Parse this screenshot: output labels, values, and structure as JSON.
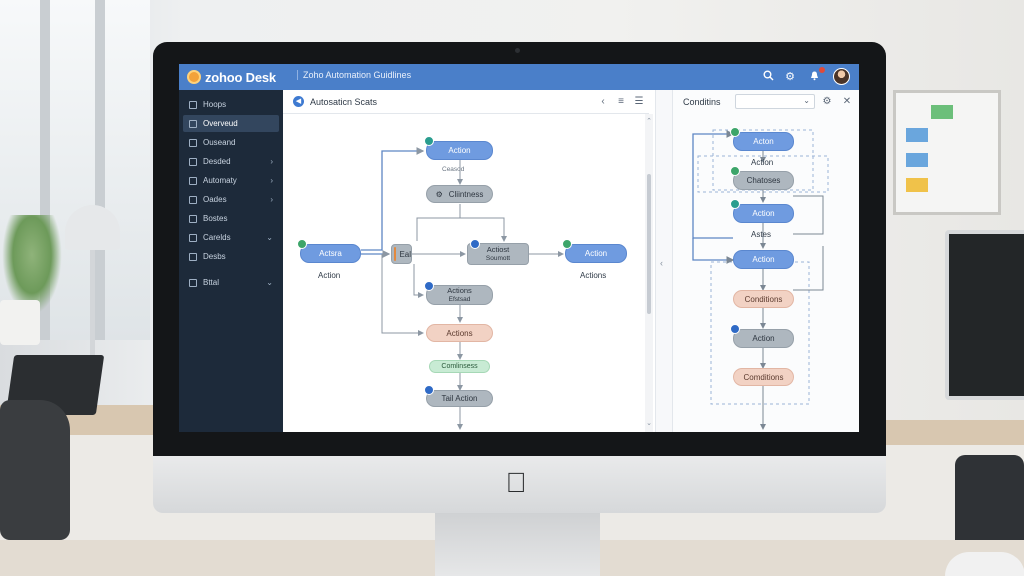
{
  "app": {
    "logo_text": "zohoo Desk",
    "breadcrumb": "Zoho Automation Guidlines"
  },
  "sidebar": {
    "items": [
      {
        "label": "Hoops",
        "chevron": false,
        "active": false
      },
      {
        "label": "Overveud",
        "chevron": false,
        "active": true
      },
      {
        "label": "Ouseand",
        "chevron": false,
        "active": false
      },
      {
        "label": "Desded",
        "chevron": true,
        "active": false
      },
      {
        "label": "Automaty",
        "chevron": true,
        "active": false
      },
      {
        "label": "Oades",
        "chevron": true,
        "active": false
      },
      {
        "label": "Bostes",
        "chevron": false,
        "active": false
      },
      {
        "label": "Carelds",
        "chevron": true,
        "active": false
      },
      {
        "label": "Desbs",
        "chevron": false,
        "active": false
      },
      {
        "label": "Bttal",
        "chevron": true,
        "active": false
      }
    ]
  },
  "canvas": {
    "title": "Autosaticn Scats",
    "nodes": {
      "top_action": "Action",
      "top_caption": "Ceasod",
      "conditions1": "Cliintness",
      "left_action": "Actsra",
      "left_caption": "Action",
      "eal": "Eal",
      "mid_action_l1": "Actiost",
      "mid_action_l2": "Soumott",
      "right_action": "Action",
      "right_caption": "Actions",
      "lower_action_l1": "Actions",
      "lower_action_l2": "Efstsad",
      "salmon_actions": "Actions",
      "green_conditions": "Comlinsess",
      "tall_action": "Tail Action"
    }
  },
  "right_panel": {
    "title": "Conditins",
    "select_value": "",
    "nodes": {
      "action1": "Acton",
      "caption1": "Action",
      "conditions": "Chatoses",
      "action2": "Action",
      "caption2": "Astes",
      "action3": "Action",
      "condition_salmon": "Conditions",
      "action4": "Action",
      "condition_salmon2": "Comditions"
    }
  },
  "icons": {
    "search": "search-icon",
    "settings": "gear-icon",
    "bell": "bell-icon",
    "avatar": "user-avatar"
  },
  "colors": {
    "topbar": "#4a7fc9",
    "sidebar": "#1d2a3a",
    "node_blue": "#6f9be0",
    "node_gray": "#aeb7bf",
    "node_salmon": "#f2d2c4",
    "node_green": "#c8ebd4"
  }
}
